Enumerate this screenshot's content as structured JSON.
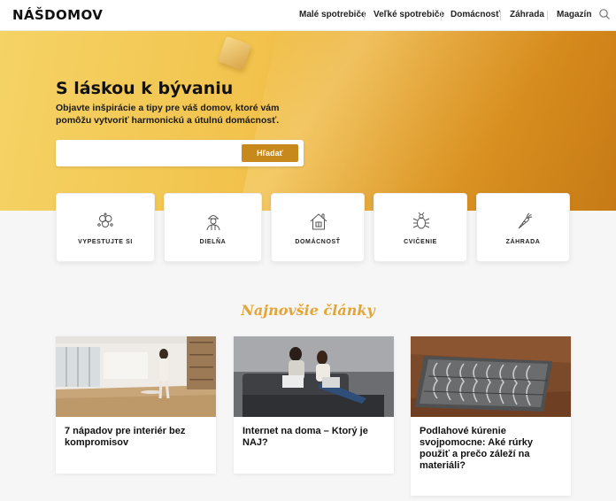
{
  "header": {
    "logo": "NÁŠDOMOV",
    "nav": [
      {
        "label": "Malé spotrebiče"
      },
      {
        "label": "Veľké spotrebiče"
      },
      {
        "label": "Domácnosť"
      },
      {
        "label": "Záhrada"
      },
      {
        "label": "Magazín"
      }
    ],
    "search_icon": "search-icon"
  },
  "hero": {
    "title": "S láskou k bývaniu",
    "subtitle": "Objavte inšpirácie a tipy pre váš domov, ktoré vám pomôžu vytvoriť harmonickú a útulnú domácnosť.",
    "search_placeholder": "",
    "search_button": "Hľadať",
    "accent": "#c8891c"
  },
  "categories": [
    {
      "label": "VYPESTUJTE SI",
      "icon": "seeds-icon"
    },
    {
      "label": "DIELŇA",
      "icon": "worker-icon"
    },
    {
      "label": "DOMÁCNOSŤ",
      "icon": "house-icon"
    },
    {
      "label": "CVIČENIE",
      "icon": "bug-icon"
    },
    {
      "label": "ZÁHRADA",
      "icon": "carrot-icon"
    }
  ],
  "latest": {
    "title": "Najnovšie články",
    "articles": [
      {
        "title": "7 nápadov pre interiér bez kompromisov"
      },
      {
        "title": "Internet na doma – Ktorý je NAJ?"
      },
      {
        "title": "Podlahové kúrenie svojpomocne: Aké rúrky použiť a prečo záleží na materiáli?"
      }
    ]
  }
}
